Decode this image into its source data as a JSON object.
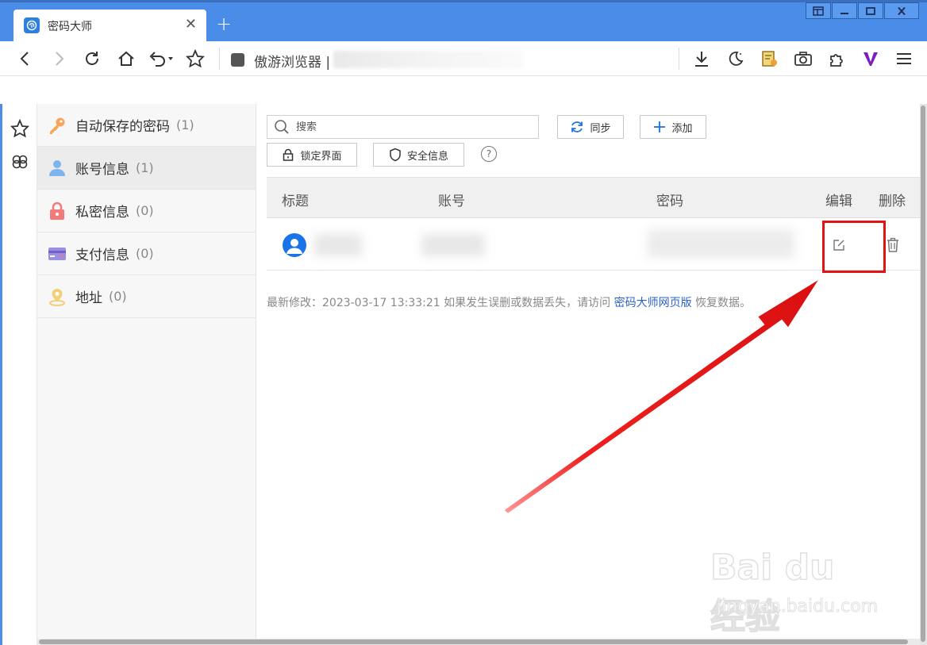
{
  "window": {
    "tab_title": "密码大师",
    "tab_close": "✕",
    "new_tab": "+"
  },
  "navbar": {
    "browser_name": "傲游浏览器 |"
  },
  "sidebar": {
    "categories": [
      {
        "label": "自动保存的密码",
        "count": "(1)",
        "icon": "key-icon"
      },
      {
        "label": "账号信息",
        "count": "(1)",
        "icon": "user-icon"
      },
      {
        "label": "私密信息",
        "count": "(0)",
        "icon": "lock-icon"
      },
      {
        "label": "支付信息",
        "count": "(0)",
        "icon": "card-icon"
      },
      {
        "label": "地址",
        "count": "(0)",
        "icon": "location-icon"
      }
    ]
  },
  "toolbar": {
    "search_placeholder": "搜索",
    "sync_label": "同步",
    "add_label": "添加",
    "lock_label": "锁定界面",
    "security_label": "安全信息",
    "help_label": "?"
  },
  "table": {
    "headers": {
      "title": "标题",
      "account": "账号",
      "password": "密码",
      "edit": "编辑",
      "delete": "删除"
    }
  },
  "footer": {
    "text_before": "最新修改：2023-03-17 13:33:21 如果发生误删或数据丢失，请访问 ",
    "link": "密码大师网页版",
    "text_after": " 恢复数据。"
  },
  "watermark": {
    "main": "Bai du 经验",
    "sub": "jingyan.baidu.com"
  },
  "colors": {
    "titlebar": "#4a8de8",
    "accent": "#1a73e8",
    "highlight": "#e11414",
    "arrow": "#e31212"
  }
}
